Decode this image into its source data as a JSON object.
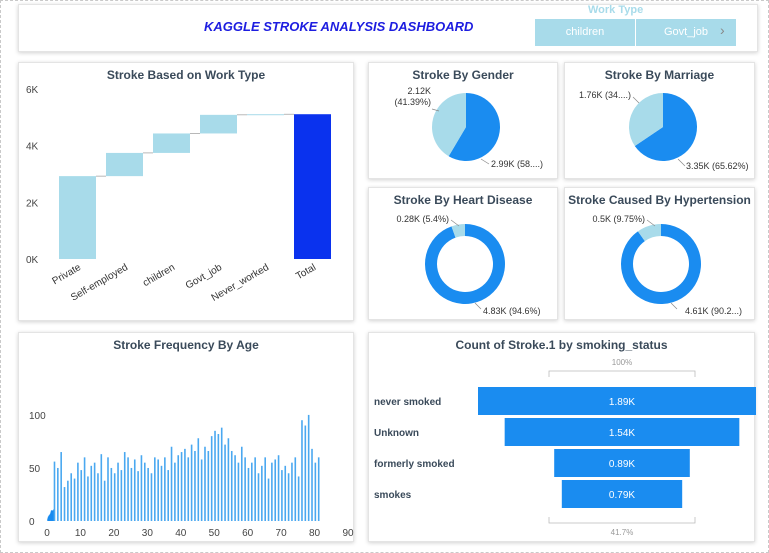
{
  "header": {
    "title": "KAGGLE STROKE ANALYSIS DASHBOARD",
    "slicer_label": "Work Type",
    "slicer_options": [
      "children",
      "Govt_job"
    ],
    "next_icon": "chevron-right-icon"
  },
  "colors": {
    "light_blue": "#a8dbea",
    "blue": "#1a8cf0",
    "dark_blue": "#0a32ee",
    "title_blue": "#1d1de0"
  },
  "chart_data": [
    {
      "id": "waterfall",
      "type": "bar",
      "subtype": "waterfall",
      "title": "Stroke Based on Work Type",
      "categories": [
        "Private",
        "Self-employed",
        "children",
        "Govt_job",
        "Never_worked",
        "Total"
      ],
      "values": [
        2925,
        819,
        687,
        657,
        22,
        5110
      ],
      "yticks": [
        "0K",
        "2K",
        "4K",
        "6K"
      ],
      "ylim": [
        0,
        6000
      ]
    },
    {
      "id": "gender",
      "type": "pie",
      "title": "Stroke By Gender",
      "values": [
        2120,
        2990
      ],
      "labels": [
        "2.12K\n(41.39%)",
        "2.99K (58....)"
      ]
    },
    {
      "id": "marriage",
      "type": "pie",
      "title": "Stroke By Marriage",
      "values": [
        1760,
        3350
      ],
      "labels": [
        "1.76K (34....)",
        "3.35K (65.62%)"
      ]
    },
    {
      "id": "heart",
      "type": "pie",
      "subtype": "donut",
      "title": "Stroke By Heart Disease",
      "values": [
        280,
        4830
      ],
      "labels": [
        "0.28K (5.4%)",
        "4.83K (94.6%)"
      ]
    },
    {
      "id": "hyper",
      "type": "pie",
      "subtype": "donut",
      "title": "Stroke Caused By Hypertension",
      "values": [
        500,
        4610
      ],
      "labels": [
        "0.5K (9.75%)",
        "4.61K (90.2...)"
      ]
    },
    {
      "id": "age",
      "type": "bar",
      "title": "Stroke Frequency By Age",
      "xticks": [
        "0",
        "10",
        "20",
        "30",
        "40",
        "50",
        "60",
        "70",
        "80",
        "90"
      ],
      "yticks": [
        "0",
        "50",
        "100"
      ],
      "xlim": [
        0,
        90
      ],
      "ylim": [
        0,
        115
      ],
      "x": [
        0.08,
        0.16,
        0.24,
        0.32,
        0.4,
        0.48,
        0.56,
        0.64,
        0.72,
        0.8,
        0.88,
        1,
        1.08,
        1.16,
        1.24,
        1.32,
        1.4,
        1.48,
        1.56,
        1.64,
        1.72,
        1.8,
        1.88,
        2,
        3,
        4,
        5,
        6,
        7,
        8,
        9,
        10,
        11,
        12,
        13,
        14,
        15,
        16,
        17,
        18,
        19,
        20,
        21,
        22,
        23,
        24,
        25,
        26,
        27,
        28,
        29,
        30,
        31,
        32,
        33,
        34,
        35,
        36,
        37,
        38,
        39,
        40,
        41,
        42,
        43,
        44,
        45,
        46,
        47,
        48,
        49,
        50,
        51,
        52,
        53,
        54,
        55,
        56,
        57,
        58,
        59,
        60,
        61,
        62,
        63,
        64,
        65,
        66,
        67,
        68,
        69,
        70,
        71,
        72,
        73,
        74,
        75,
        76,
        77,
        78,
        79,
        80,
        81,
        82
      ],
      "values": [
        2,
        3,
        4,
        4,
        5,
        5,
        5,
        6,
        6,
        6,
        7,
        8,
        9,
        10,
        10,
        9,
        8,
        8,
        9,
        10,
        9,
        10,
        11,
        56,
        50,
        65,
        32,
        38,
        45,
        40,
        55,
        48,
        60,
        42,
        52,
        55,
        45,
        63,
        38,
        60,
        50,
        45,
        55,
        48,
        65,
        60,
        50,
        58,
        47,
        62,
        55,
        50,
        45,
        60,
        58,
        52,
        60,
        48,
        70,
        55,
        62,
        65,
        68,
        60,
        72,
        66,
        78,
        58,
        70,
        66,
        80,
        85,
        82,
        88,
        72,
        78,
        66,
        62,
        55,
        70,
        60,
        50,
        55,
        60,
        45,
        52,
        60,
        40,
        55,
        58,
        62,
        48,
        52,
        45,
        55,
        60,
        42,
        95,
        90,
        100,
        68,
        55,
        60
      ]
    },
    {
      "id": "smoking",
      "type": "bar",
      "subtype": "funnel",
      "title": "Count of Stroke.1 by smoking_status",
      "categories": [
        "never smoked",
        "Unknown",
        "formerly smoked",
        "smokes"
      ],
      "values": [
        1890,
        1540,
        890,
        790
      ],
      "value_labels": [
        "1.89K",
        "1.54K",
        "0.89K",
        "0.79K"
      ],
      "top_label": "100%",
      "bottom_label": "41.7%"
    }
  ]
}
